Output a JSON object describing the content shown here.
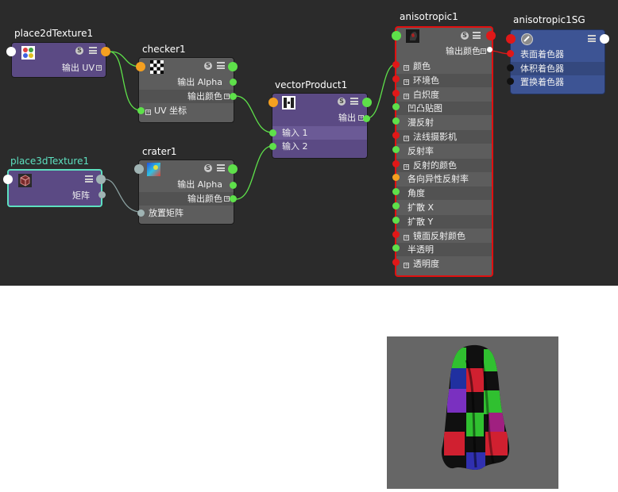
{
  "nodes": {
    "place2d": {
      "title": "place2dTexture1",
      "out_uv": "输出 UV"
    },
    "checker": {
      "title": "checker1",
      "out_alpha": "输出 Alpha",
      "out_color": "输出颜色",
      "uv": "UV 坐标"
    },
    "place3d": {
      "title": "place3dTexture1",
      "matrix": "矩阵"
    },
    "crater": {
      "title": "crater1",
      "out_alpha": "输出 Alpha",
      "out_color": "输出颜色",
      "placement": "放置矩阵"
    },
    "vector": {
      "title": "vectorProduct1",
      "out": "输出",
      "in1": "输入 1",
      "in2": "输入 2"
    },
    "aniso": {
      "title": "anisotropic1",
      "out_color": "输出颜色",
      "attrs": [
        "颜色",
        "环境色",
        "白炽度",
        "凹凸贴图",
        "漫反射",
        "法线摄影机",
        "反射率",
        "反射的颜色",
        "各向异性反射率",
        "角度",
        "扩散 X",
        "扩散 Y",
        "镜面反射颜色",
        "半透明",
        "透明度"
      ]
    },
    "sg": {
      "title": "anisotropic1SG",
      "attrs": [
        "表面着色器",
        "体积着色器",
        "置换着色器"
      ]
    }
  },
  "colors": {
    "attr_green": "#5ee04a",
    "attr_orange": "#f5a020",
    "attr_red": "#e01818",
    "selection_red": "#e01010",
    "selection_cyan": "#5de0c0"
  }
}
